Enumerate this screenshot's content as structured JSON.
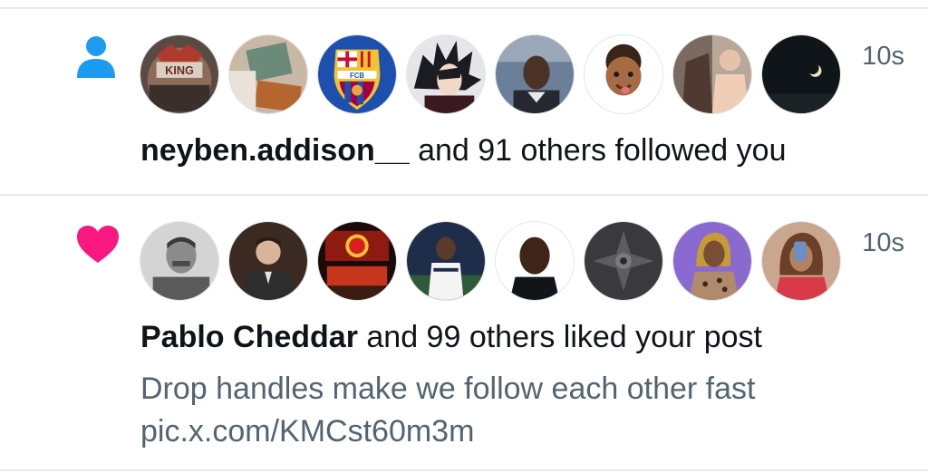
{
  "colors": {
    "follow_icon": "#1d9bf0",
    "like_icon": "#f91880",
    "secondary_text": "#536471",
    "primary_text": "#0f1419",
    "divider": "#e7e9ea"
  },
  "notifications": [
    {
      "type": "follow",
      "icon": "person-icon",
      "time": "10s",
      "actor": "neyben.addison__",
      "rest": " and 91 others followed you",
      "avatars": [
        "king-logo-avatar",
        "photo-avatar",
        "fcb-crest-avatar",
        "anime-character-avatar",
        "selfie-avatar",
        "memoji-avatar",
        "shirtless-photo-avatar",
        "night-moon-avatar"
      ]
    },
    {
      "type": "like",
      "icon": "heart-icon",
      "time": "10s",
      "actor": "Pablo Cheddar",
      "rest": " and 99 others liked your post",
      "post_line1": "Drop handles make we follow each other fast",
      "post_line2": "pic.x.com/KMCst60m3m",
      "avatars": [
        "bw-portrait-avatar",
        "suited-man-avatar",
        "manchester-united-avatar",
        "footballer-avatar",
        "man-portrait-avatar",
        "dark-emblem-avatar",
        "woman-purple-avatar",
        "woman-selfie-avatar"
      ]
    }
  ]
}
